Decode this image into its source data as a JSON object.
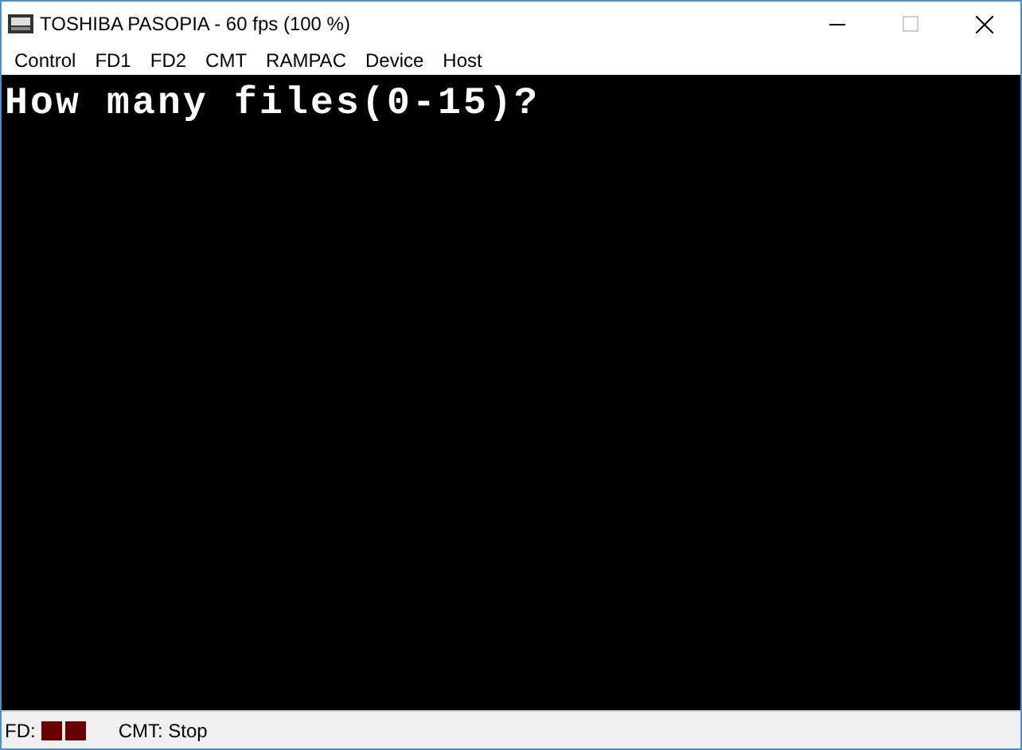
{
  "window": {
    "title": "TOSHIBA PASOPIA - 60 fps (100 %)"
  },
  "menu": [
    "Control",
    "FD1",
    "FD2",
    "CMT",
    "RAMPAC",
    "Device",
    "Host"
  ],
  "screen": {
    "lines": [
      "How many files(0-15)?"
    ]
  },
  "status_bar": {
    "fd_label": "FD:",
    "drives": [
      {
        "on": false
      },
      {
        "on": false
      }
    ],
    "cmt": "CMT: Stop"
  }
}
